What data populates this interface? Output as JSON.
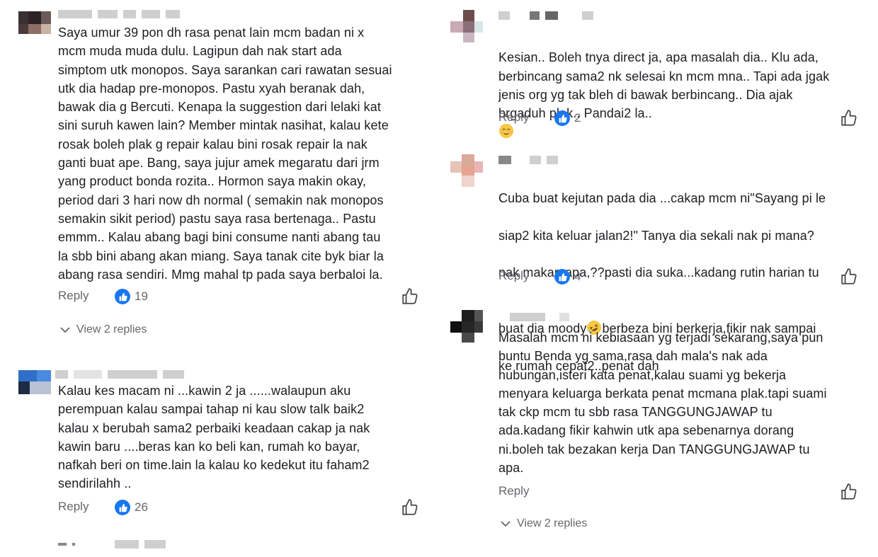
{
  "left": {
    "c1": {
      "lines": "Saya umur 39 pon dh rasa penat lain mcm badan ni x\nmcm muda muda dulu. Lagipun dah nak start ada\nsimptom utk monopos. Saya sarankan cari rawatan sesuai\nutk dia hadap pre-monopos. Pastu xyah beranak dah,\nbawak dia g Bercuti. Kenapa la suggestion dari lelaki kat\nsini suruh kawen lain? Member mintak nasihat, kalau kete\nrosak boleh plak g repair kalau bini rosak repair la nak\nganti buat ape. Bang, saya jujur amek megaratu dari jrm\nyang product bonda rozita.. Hormon saya makin okay,\nperiod dari 3 hari now dh normal ( semakin nak monopos\nsemakin sikit period) pastu saya rasa bertenaga.. Pastu\nemmm.. Kalau abang bagi bini consume nanti abang tau\nla sbb bini abang akan miang. Saya tanak cite byk biar la\nabang rasa sendiri. Mmg mahal tp pada saya berbaloi la.",
      "reply": "Reply",
      "likes": "19",
      "view_replies": "View 2 replies"
    },
    "c2": {
      "lines": "Kalau kes macam ni ...kawin 2 ja ......walaupun aku\nperempuan kalau sampai tahap ni kau slow talk baik2\nkalau x berubah sama2 perbaiki keadaan cakap ja nak\nkawin baru ....beras kan ko beli kan, rumah ko bayar,\nnafkah beri on time.lain la kalau ko kedekut itu faham2\nsendirilahh ..",
      "reply": "Reply",
      "likes": "26"
    }
  },
  "right": {
    "c1": {
      "lines": "Kesian.. Boleh tnya direct ja, apa masalah dia.. Klu ada,\nberbincang sama2 nk selesai kn mcm mna.. Tapi ada jgak\njenis org yg tak bleh di bawak berbincang.. Dia ajak\nbrgaduh plak.. Pandai2 la..",
      "reply": "Reply",
      "likes": "2"
    },
    "c2": {
      "line1": "Cuba buat kejutan  pada dia ...cakap mcm ni\"Sayang pi le",
      "line2": "siap2 kita keluar jalan2!\" Tanya dia sekali nak pi mana?",
      "line3": "nak makan apa,??pasti dia suka...kadang rutin harian tu",
      "line4a": "buat dia moody",
      "line4b": "berbeza bini berkerja,fikir nak sampai",
      "line5": "ke rumah cepat2..penat dah",
      "reply": "Reply",
      "likes": "4"
    },
    "c3": {
      "lines": "Masalah mcm ni kebiasaan yg terjadi sekarang,saya pun\nbuntu Benda yg sama,rasa dah mala's nak ada\nhubungan,isteri kata penat,kalau suami yg bekerja\nmenyara keluarga berkata penat mcmana plak.tapi suami\ntak ckp mcm tu sbb rasa TANGGUNGJAWAP tu\nada.kadang fikir kahwin utk apa sebenarnya dorang\nni.boleh tak bezakan kerja Dan TANGGUNGJAWAP tu\napa.",
      "reply": "Reply",
      "view_replies": "View 2 replies"
    }
  },
  "icons": {
    "like_badge": "like-badge-icon",
    "thumb": "thumbs-up-outline-icon",
    "chevron": "chevron-down-icon",
    "emoji_relieved": "relieved-face-emoji",
    "emoji_rofl": "rolling-laughing-emoji"
  },
  "colors": {
    "accent": "#1877f2",
    "secondary_text": "#65676b",
    "primary_text": "#1c1e21"
  }
}
